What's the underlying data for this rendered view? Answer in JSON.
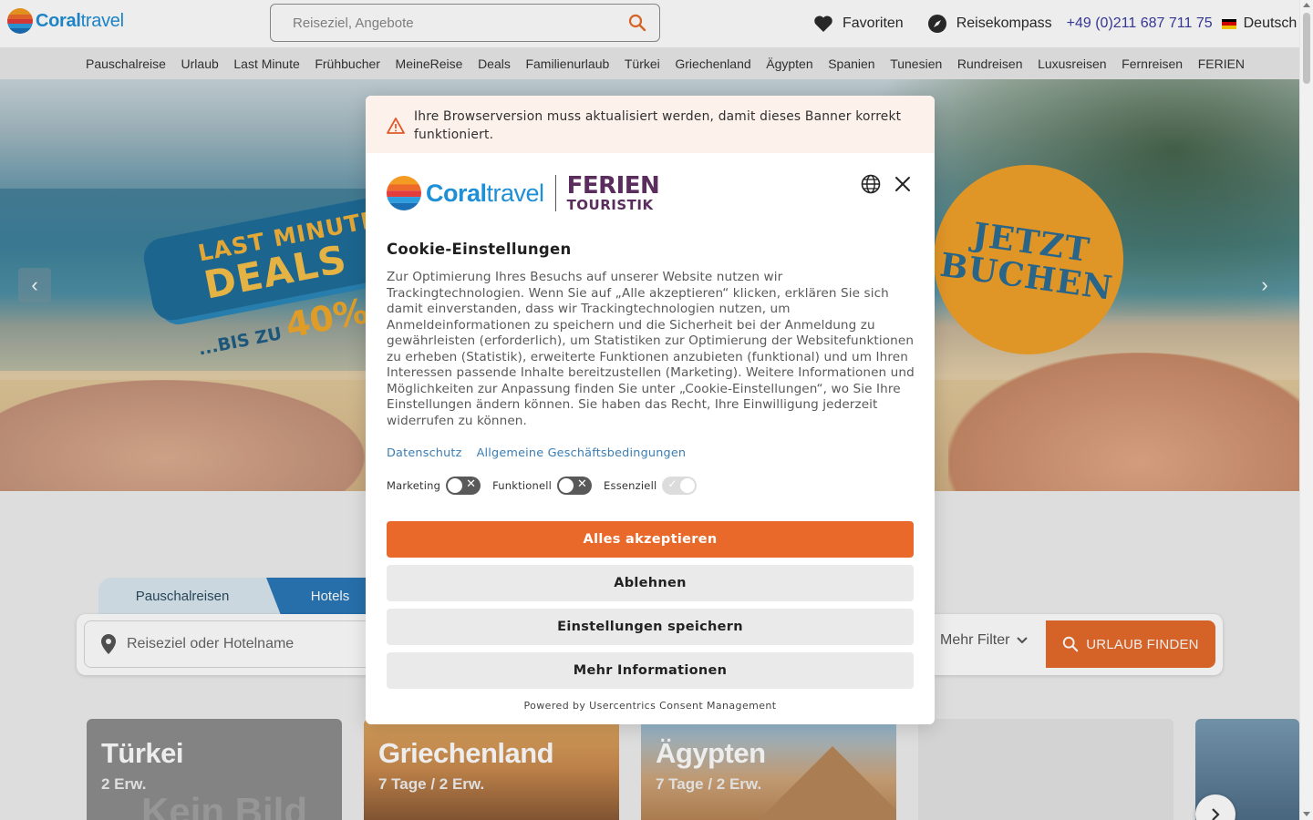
{
  "header": {
    "logo_text_bold": "Coral",
    "logo_text_light": "travel",
    "search_placeholder": "Reiseziel, Angebote",
    "favorites_label": "Favoriten",
    "compass_label": "Reisekompass",
    "phone": "+49 (0)211 687 711 75",
    "language": "Deutsch"
  },
  "nav": {
    "items": [
      "Pauschalreise",
      "Urlaub",
      "Last Minute",
      "Frühbucher",
      "MeineReise",
      "Deals",
      "Familienurlaub",
      "Türkei",
      "Griechenland",
      "Ägypten",
      "Spanien",
      "Tunesien",
      "Rundreisen",
      "Luxusreisen",
      "Fernreisen",
      "FERIEN"
    ]
  },
  "hero": {
    "promo_line1": "LAST MINUTE",
    "promo_line2": "DEALS",
    "promo_line3": "...BIS ZU",
    "promo_percent": "40%",
    "badge_line1": "JETZT",
    "badge_line2": "BUCHEN",
    "prev_icon": "‹",
    "next_icon": "›"
  },
  "search_panel": {
    "tabs": [
      "Pauschalreisen",
      "Hotels"
    ],
    "destination_placeholder": "Reiseziel oder Hotelname",
    "more_filter_label": "Mehr Filter",
    "find_button_label": "URLAUB FINDEN"
  },
  "cards": [
    {
      "title": "Türkei",
      "subtitle": "2 Erw.",
      "ghost": "Kein Bild"
    },
    {
      "title": "Griechenland",
      "subtitle": "7 Tage / 2 Erw."
    },
    {
      "title": "Ägypten",
      "subtitle": "7 Tage / 2 Erw."
    }
  ],
  "cookie_modal": {
    "warning_text": "Ihre Browserversion muss aktualisiert werden, damit dieses Banner korrekt funktioniert.",
    "logo_coral_bold": "Coral",
    "logo_coral_light": "travel",
    "logo_ferien_line1": "FERIEN",
    "logo_ferien_line2": "TOURISTIK",
    "title": "Cookie-Einstellungen",
    "body": "Zur Optimierung Ihres Besuchs auf unserer Website nutzen wir Trackingtechnologien. Wenn Sie auf „Alle akzeptieren“ klicken, erklären Sie sich damit einverstanden, dass wir Trackingtechnologien nutzen, um Anmeldeinformationen zu speichern und die Sicherheit bei der Anmeldung zu gewährleisten (erforderlich), um Statistiken zur Optimierung der Websitefunktionen zu erheben (Statistik), erweiterte Funktionen anzubieten (funktional) und um Ihren Interessen passende Inhalte bereitzustellen (Marketing). Weitere Informationen und Möglichkeiten zur Anpassung finden Sie unter „Cookie-Einstellungen“, wo Sie Ihre Einstellungen ändern können. Sie haben das Recht, Ihre Einwilligung jederzeit widerrufen zu können.",
    "links": [
      "Datenschutz",
      "Allgemeine Geschäftsbedingungen"
    ],
    "toggles": [
      {
        "label": "Marketing",
        "state": "off"
      },
      {
        "label": "Funktionell",
        "state": "off"
      },
      {
        "label": "Essenziell",
        "state": "on-disabled"
      }
    ],
    "accept_label": "Alles akzeptieren",
    "reject_label": "Ablehnen",
    "save_label": "Einstellungen speichern",
    "more_label": "Mehr Informationen",
    "powered_by": "Powered by Usercentrics Consent Management"
  },
  "colors": {
    "brand_blue": "#1f8fd6",
    "accent_orange": "#e8692a",
    "phone_blue": "#3a3c9e",
    "ferien_purple": "#5a2d5e"
  }
}
